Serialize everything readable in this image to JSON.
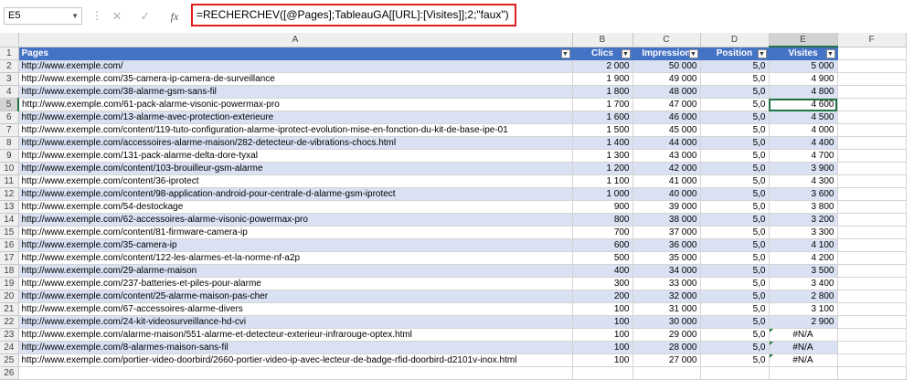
{
  "formula_bar": {
    "name_box": "E5",
    "cancel_icon": "✕",
    "enter_icon": "✓",
    "fx_label": "fx",
    "formula": "=RECHERCHEV([@Pages];TableauGA[[URL]:[Visites]];2;\"faux\")"
  },
  "columns": [
    "A",
    "B",
    "C",
    "D",
    "E",
    "F"
  ],
  "table": {
    "headers": [
      "Pages",
      "Clics",
      "Impression",
      "Position",
      "Visites"
    ],
    "rows": [
      [
        "http://www.exemple.com/",
        "2 000",
        "50 000",
        "5,0",
        "5 000"
      ],
      [
        "http://www.exemple.com/35-camera-ip-camera-de-surveillance",
        "1 900",
        "49 000",
        "5,0",
        "4 900"
      ],
      [
        "http://www.exemple.com/38-alarme-gsm-sans-fil",
        "1 800",
        "48 000",
        "5,0",
        "4 800"
      ],
      [
        "http://www.exemple.com/61-pack-alarme-visonic-powermax-pro",
        "1 700",
        "47 000",
        "5,0",
        "4 600"
      ],
      [
        "http://www.exemple.com/13-alarme-avec-protection-exterieure",
        "1 600",
        "46 000",
        "5,0",
        "4 500"
      ],
      [
        "http://www.exemple.com/content/119-tuto-configuration-alarme-iprotect-evolution-mise-en-fonction-du-kit-de-base-ipe-01",
        "1 500",
        "45 000",
        "5,0",
        "4 000"
      ],
      [
        "http://www.exemple.com/accessoires-alarme-maison/282-detecteur-de-vibrations-chocs.html",
        "1 400",
        "44 000",
        "5,0",
        "4 400"
      ],
      [
        "http://www.exemple.com/131-pack-alarme-delta-dore-tyxal",
        "1 300",
        "43 000",
        "5,0",
        "4 700"
      ],
      [
        "http://www.exemple.com/content/103-brouilleur-gsm-alarme",
        "1 200",
        "42 000",
        "5,0",
        "3 900"
      ],
      [
        "http://www.exemple.com/content/36-iprotect",
        "1 100",
        "41 000",
        "5,0",
        "4 300"
      ],
      [
        "http://www.exemple.com/content/98-application-android-pour-centrale-d-alarme-gsm-iprotect",
        "1 000",
        "40 000",
        "5,0",
        "3 600"
      ],
      [
        "http://www.exemple.com/54-destockage",
        "900",
        "39 000",
        "5,0",
        "3 800"
      ],
      [
        "http://www.exemple.com/62-accessoires-alarme-visonic-powermax-pro",
        "800",
        "38 000",
        "5,0",
        "3 200"
      ],
      [
        "http://www.exemple.com/content/81-firmware-camera-ip",
        "700",
        "37 000",
        "5,0",
        "3 300"
      ],
      [
        "http://www.exemple.com/35-camera-ip",
        "600",
        "36 000",
        "5,0",
        "4 100"
      ],
      [
        "http://www.exemple.com/content/122-les-alarmes-et-la-norme-nf-a2p",
        "500",
        "35 000",
        "5,0",
        "4 200"
      ],
      [
        "http://www.exemple.com/29-alarme-maison",
        "400",
        "34 000",
        "5,0",
        "3 500"
      ],
      [
        "http://www.exemple.com/237-batteries-et-piles-pour-alarme",
        "300",
        "33 000",
        "5,0",
        "3 400"
      ],
      [
        "http://www.exemple.com/content/25-alarme-maison-pas-cher",
        "200",
        "32 000",
        "5,0",
        "2 800"
      ],
      [
        "http://www.exemple.com/67-accessoires-alarme-divers",
        "100",
        "31 000",
        "5,0",
        "3 100"
      ],
      [
        "http://www.exemple.com/24-kit-videosurveillance-hd-cvi",
        "100",
        "30 000",
        "5,0",
        "2 900"
      ],
      [
        "http://www.exemple.com/alarme-maison/551-alarme-et-detecteur-exterieur-infrarouge-optex.html",
        "100",
        "29 000",
        "5,0",
        "#N/A"
      ],
      [
        "http://www.exemple.com/8-alarmes-maison-sans-fil",
        "100",
        "28 000",
        "5,0",
        "#N/A"
      ],
      [
        "http://www.exemple.com/portier-video-doorbird/2660-portier-video-ip-avec-lecteur-de-badge-rfid-doorbird-d2101v-inox.html",
        "100",
        "27 000",
        "5,0",
        "#N/A"
      ]
    ]
  },
  "row_numbers": [
    "1",
    "2",
    "3",
    "4",
    "5",
    "6",
    "7",
    "8",
    "9",
    "10",
    "11",
    "12",
    "13",
    "14",
    "15",
    "16",
    "17",
    "18",
    "19",
    "20",
    "21",
    "22",
    "23",
    "24",
    "25",
    "26"
  ],
  "selected_row": 5,
  "selected_col": "E",
  "colors": {
    "header_blue": "#4472c4",
    "band": "#d9e1f2",
    "select_green": "#217346",
    "error_triangle": "#1e7a42"
  }
}
